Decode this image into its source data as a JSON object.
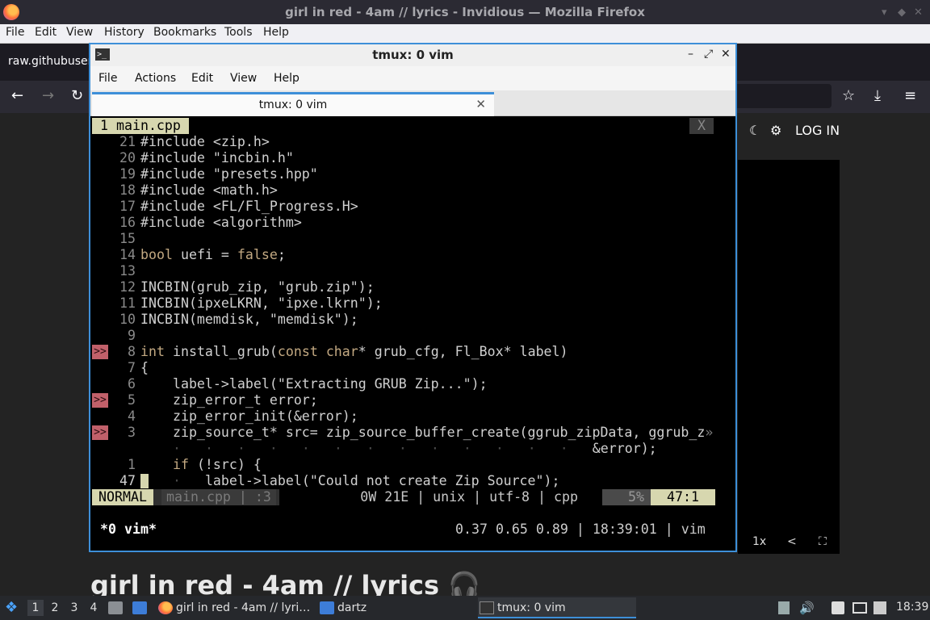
{
  "firefox": {
    "window_title": "girl in red - 4am // lyrics - Invidious — Mozilla Firefox",
    "menu": [
      "File",
      "Edit",
      "View",
      "History",
      "Bookmarks",
      "Tools",
      "Help"
    ],
    "tab_label": "raw.githubuser",
    "page": {
      "log_in": "LOG IN",
      "video_title": "girl in red - 4am // lyrics",
      "speed": "1x"
    }
  },
  "terminal": {
    "title": "tmux: 0 vim",
    "menu": [
      "File",
      "Actions",
      "Edit",
      "View",
      "Help"
    ],
    "tab_title": "tmux: 0 vim"
  },
  "vim": {
    "buffer_tab": "1 main.cpp",
    "buffer_close": "X",
    "lines": [
      {
        "num": "21",
        "text": "#include <zip.h>"
      },
      {
        "num": "20",
        "text": "#include \"incbin.h\""
      },
      {
        "num": "19",
        "text": "#include \"presets.hpp\""
      },
      {
        "num": "18",
        "text": "#include <math.h>"
      },
      {
        "num": "17",
        "text": "#include <FL/Fl_Progress.H>"
      },
      {
        "num": "16",
        "text": "#include <algorithm>"
      },
      {
        "num": "15",
        "text": ""
      },
      {
        "num": "14",
        "text": "bool uefi = false;"
      },
      {
        "num": "13",
        "text": ""
      },
      {
        "num": "12",
        "text": "INCBIN(grub_zip, \"grub.zip\");"
      },
      {
        "num": "11",
        "text": "INCBIN(ipxeLKRN, \"ipxe.lkrn\");"
      },
      {
        "num": "10",
        "text": "INCBIN(memdisk, \"memdisk\");"
      },
      {
        "num": "9",
        "text": ""
      },
      {
        "num": "8",
        "text": "int install_grub(const char* grub_cfg, Fl_Box* label)",
        "sign": ">>"
      },
      {
        "num": "7",
        "text": "{"
      },
      {
        "num": "6",
        "text": "    label->label(\"Extracting GRUB Zip...\");"
      },
      {
        "num": "5",
        "text": "    zip_error_t error;",
        "sign": ">>"
      },
      {
        "num": "4",
        "text": "    zip_error_init(&error);"
      },
      {
        "num": "3",
        "text": "    zip_source_t* src= zip_source_buffer_create(ggrub_zipData, ggrub_z»",
        "sign": ">>"
      },
      {
        "num": "",
        "text": "    ·   ·   ·   ·   ·   ·   ·   ·   ·   ·   ·   ·   ·   &error);"
      },
      {
        "num": "1",
        "text": "    if (!src) {"
      },
      {
        "num": "47",
        "text": "    ·   label->label(\"Could not create Zip Source\");",
        "current": true
      }
    ],
    "status": {
      "mode": "NORMAL",
      "file": "main.cpp | :3",
      "info": "0W 21E | unix | utf-8 | cpp",
      "percent": "5%",
      "position": "47:1"
    }
  },
  "tmux": {
    "window": "*0 vim*",
    "right": "0.37 0.65 0.89 | 18:39:01 | vim"
  },
  "taskbar": {
    "workspaces": [
      "1",
      "2",
      "3",
      "4"
    ],
    "tasks": [
      {
        "label": "girl in red - 4am // lyri…"
      },
      {
        "label": "dartz"
      },
      {
        "label": "tmux: 0 vim"
      }
    ],
    "clock": "18:39"
  }
}
